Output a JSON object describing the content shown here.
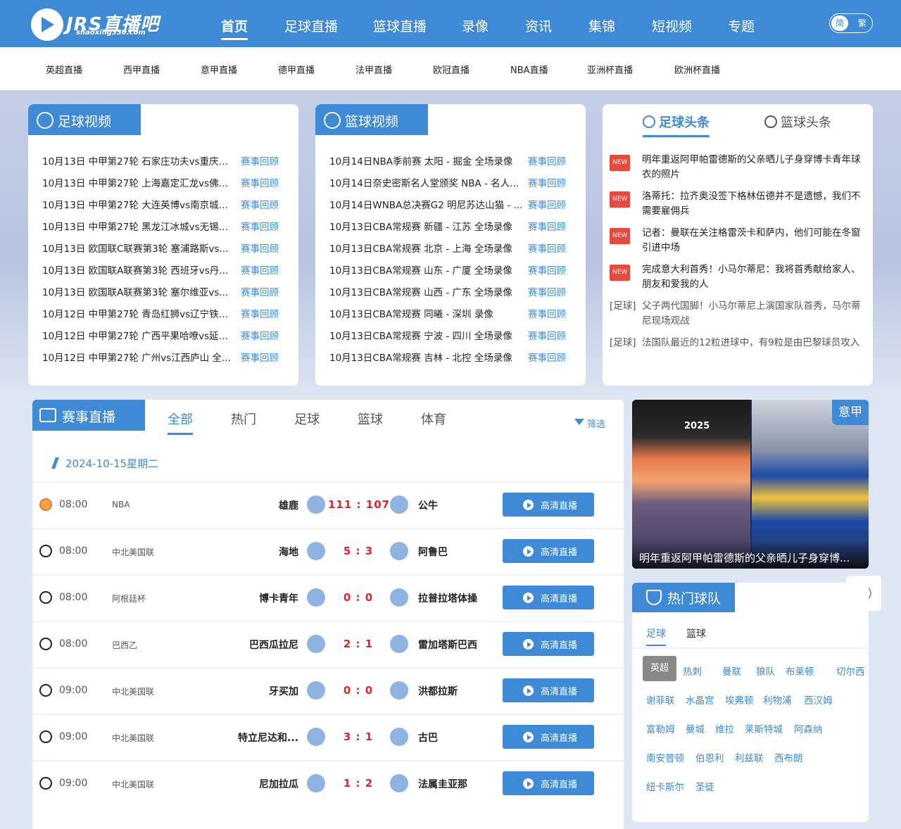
{
  "header": {
    "logo_text": "JRS直播吧",
    "logo_sub": "shaoxing330.com",
    "nav": [
      "首页",
      "足球直播",
      "篮球直播",
      "录像",
      "资讯",
      "集锦",
      "短视频",
      "专题"
    ],
    "lang_simplified": "简",
    "lang_traditional": "繁"
  },
  "subnav": [
    "英超直播",
    "西甲直播",
    "意甲直播",
    "德甲直播",
    "法甲直播",
    "欧冠直播",
    "NBA直播",
    "亚洲杯直播",
    "欧洲杯直播"
  ],
  "football_video": {
    "title": "足球视频",
    "replay_label": "赛事回顾",
    "items": [
      "10月13日 中甲第27轮 石家庄功夫vs重庆铜...",
      "10月13日 中甲第27轮 上海嘉定汇龙vs佛山...",
      "10月13日 中甲第27轮 大连英博vs南京城市...",
      "10月13日 中甲第27轮 黑龙江冰城vs无锡吴...",
      "10月13日 欧国联C联赛第3轮 塞浦路斯vs...",
      "10月13日 欧国联A联赛第3轮 西班牙vs丹...",
      "10月13日 欧国联A联赛第3轮 塞尔维亚vs...",
      "10月12日 中甲第27轮 青岛红狮vs辽宁铁人...",
      "10月12日 中甲第27轮 广西平果哈嘹vs延边...",
      "10月12日 中甲第27轮 广州vs江西庐山 全..."
    ]
  },
  "basketball_video": {
    "title": "篮球视频",
    "replay_label": "赛事回顾",
    "items": [
      "10月14日NBA季前赛 太阳 - 掘金 全场录像",
      "10月14日奈史密斯名人堂颁奖 NBA - 名人...",
      "10月14日WNBA总决赛G2 明尼苏达山猫 - ...",
      "10月13日CBA常规赛 新疆 - 江苏 全场录像",
      "10月13日CBA常规赛 北京 - 上海 全场录像",
      "10月13日CBA常规赛 山东 - 广厦 全场录像",
      "10月13日CBA常规赛 山西 - 广东 全场录像",
      "10月13日CBA常规赛 同曦 - 深圳 录像",
      "10月13日CBA常规赛 宁波 - 四川 全场录像",
      "10月13日CBA常规赛 吉林 - 北控 全场录像"
    ]
  },
  "headlines": {
    "tab_football": "足球头条",
    "tab_basketball": "篮球头条",
    "new_label": "NEW",
    "items": [
      {
        "tag": "NEW",
        "text": "明年重返阿甲帕雷德斯的父亲晒儿子身穿博卡青年球衣的照片"
      },
      {
        "tag": "NEW",
        "text": "洛蒂托：拉齐奥没签下格林伍德并不是遗憾，我们不需要雇佣兵"
      },
      {
        "tag": "NEW",
        "text": "记者：曼联在关注格雷茨卡和萨内，他们可能在冬窗引进中场"
      },
      {
        "tag": "NEW",
        "text": "完成意大利首秀！小马尔蒂尼：我将首秀献给家人、朋友和爱我的人"
      },
      {
        "tag": "[足球]",
        "text": "父子两代国脚！小马尔蒂尼上演国家队首秀，马尔蒂尼现场观战"
      },
      {
        "tag": "[足球]",
        "text": "法国队最近的12粒进球中，有9粒是由巴黎球员攻入"
      }
    ]
  },
  "live": {
    "title": "赛事直播",
    "tabs": [
      "全部",
      "热门",
      "足球",
      "篮球",
      "体育"
    ],
    "filter_label": "筛选",
    "date": "2024-10-15星期二",
    "button_label": "高清直播",
    "matches": [
      {
        "sport": "basketball",
        "time": "08:00",
        "league": "NBA",
        "home": "雄鹿",
        "score": "111 : 107",
        "away": "公牛"
      },
      {
        "sport": "football",
        "time": "08:00",
        "league": "中北美国联",
        "home": "海地",
        "score": "5 : 3",
        "away": "阿鲁巴"
      },
      {
        "sport": "football",
        "time": "08:00",
        "league": "阿根廷杯",
        "home": "博卡青年",
        "score": "0 : 0",
        "away": "拉普拉塔体操"
      },
      {
        "sport": "football",
        "time": "08:00",
        "league": "巴西乙",
        "home": "巴西瓜拉尼",
        "score": "2 : 1",
        "away": "雷加塔斯巴西"
      },
      {
        "sport": "football",
        "time": "09:00",
        "league": "中北美国联",
        "home": "牙买加",
        "score": "0 : 0",
        "away": "洪都拉斯"
      },
      {
        "sport": "football",
        "time": "09:00",
        "league": "中北美国联",
        "home": "特立尼达和...",
        "score": "3 : 1",
        "away": "古巴"
      },
      {
        "sport": "football",
        "time": "09:00",
        "league": "中北美国联",
        "home": "尼加拉瓜",
        "score": "1 : 2",
        "away": "法属圭亚那"
      }
    ]
  },
  "banner": {
    "year": "2025",
    "caption": "明年重返阿甲帕雷德斯的父亲晒儿子身穿博...",
    "tag": "意甲"
  },
  "hot_teams": {
    "title": "热门球队",
    "tabs": [
      "足球",
      "篮球"
    ],
    "league": "英超",
    "rows": [
      [
        "热刺",
        "曼联",
        "狼队",
        "布莱顿",
        "切尔西"
      ],
      [
        "谢菲联",
        "水晶宫",
        "埃弗顿",
        "利物浦",
        "西汉姆"
      ],
      [
        "富勒姆",
        "曼城",
        "维拉",
        "莱斯特城",
        "阿森纳"
      ],
      [
        "南安普顿",
        "伯恩利",
        "利兹联",
        "西布朗"
      ],
      [
        "纽卡斯尔",
        "圣徒"
      ]
    ]
  },
  "colors": {
    "brand": "#3e8ad6",
    "score": "#e0262b",
    "new_badge": "#e8493f"
  }
}
